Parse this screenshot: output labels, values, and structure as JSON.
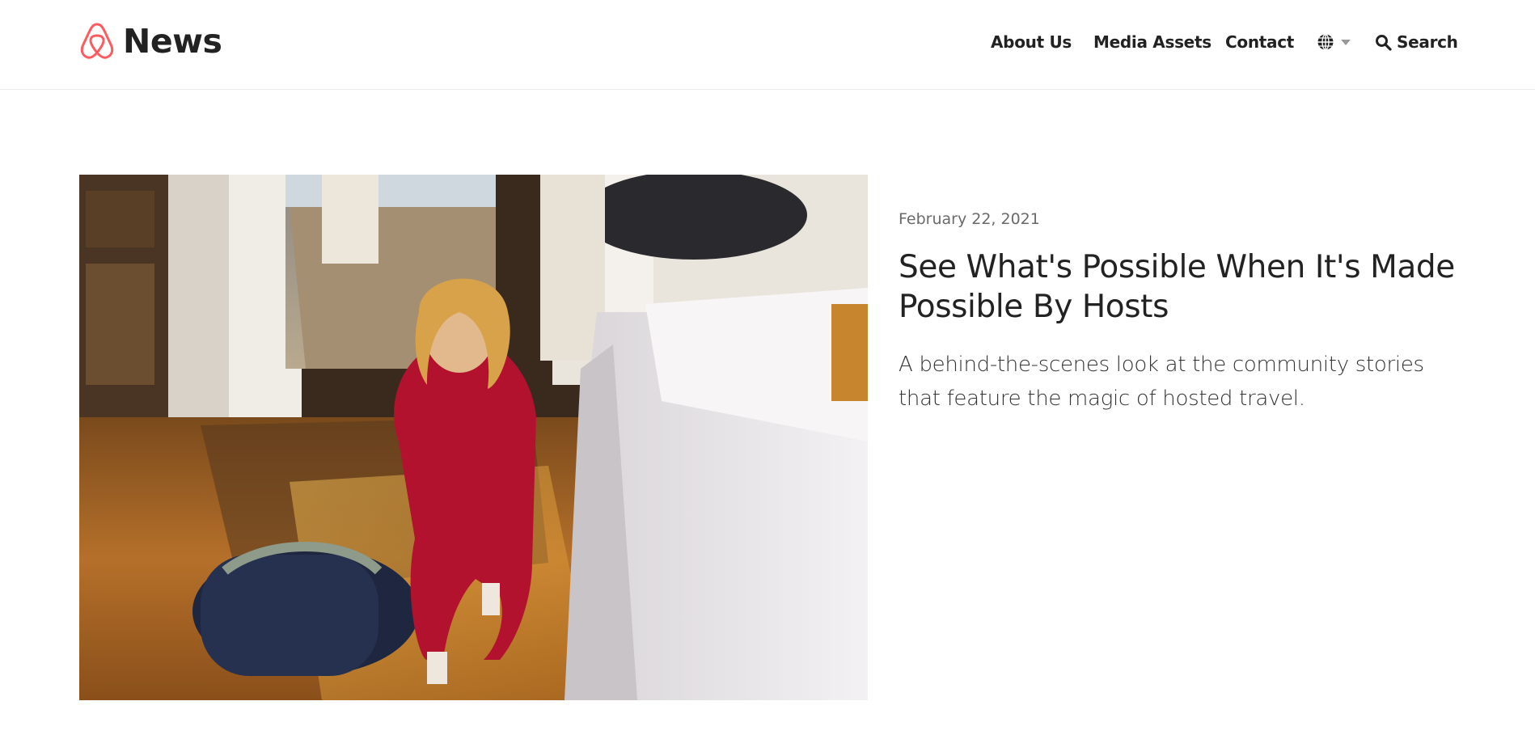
{
  "header": {
    "brand": {
      "logo_icon": "airbnb-belo-logo-icon",
      "title": "News",
      "accent": "#FF5A5F"
    },
    "nav": {
      "about": "About Us",
      "media": "Media Assets",
      "contact": "Contact",
      "language_icon": "globe-icon",
      "search_label": "Search",
      "search_icon": "search-icon"
    }
  },
  "featured": {
    "image_description_icon": "hero-photo",
    "date": "February 22, 2021",
    "title": "See What's Possible When It's Made Possible By Hosts",
    "summary": "A behind-the-scenes look at the community stories that feature the magic of hosted travel."
  },
  "colors": {
    "text": "#222222",
    "muted": "#6a6a6a",
    "border": "#ebebeb"
  }
}
